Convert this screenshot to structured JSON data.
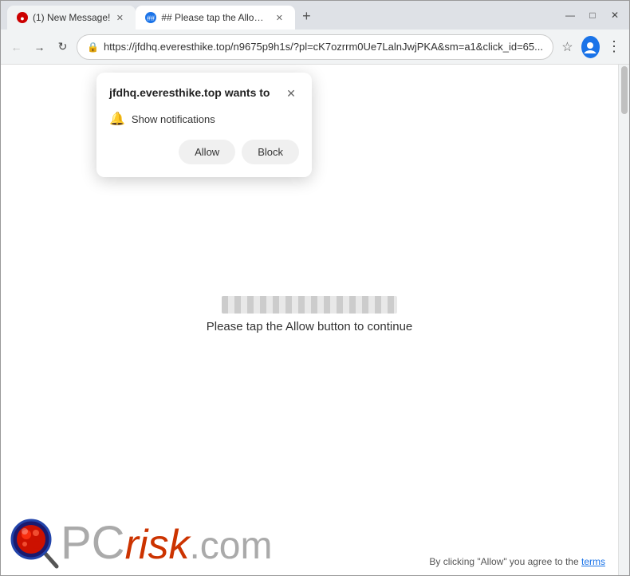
{
  "browser": {
    "tabs": [
      {
        "id": "tab1",
        "label": "(1) New Message!",
        "icon": "message-icon",
        "active": false,
        "favicon_color": "#cc0000"
      },
      {
        "id": "tab2",
        "label": "## Please tap the Allow button...",
        "icon": "warning-icon",
        "active": true,
        "favicon_color": "#1a73e8"
      }
    ],
    "new_tab_label": "+",
    "address": "https://jfdhq.everesthike.top/n9675p9h1s/?pl=cK7ozrrm0Ue7LalnJwjPKA&sm=a1&click_id=65...",
    "window_controls": {
      "minimize": "—",
      "maximize": "□",
      "close": "✕"
    }
  },
  "permission_dialog": {
    "title": "jfdhq.everesthike.top wants to",
    "close_label": "✕",
    "permission_text": "Show notifications",
    "allow_label": "Allow",
    "block_label": "Block"
  },
  "page": {
    "loading_text": "Please tap the Allow button to continue"
  },
  "bottom": {
    "notice": "By clicking \"Allow\" you agree to the",
    "terms_label": "terms",
    "logo_text": "PC",
    "logo_risk": "risk",
    "logo_dotcom": ".com"
  }
}
